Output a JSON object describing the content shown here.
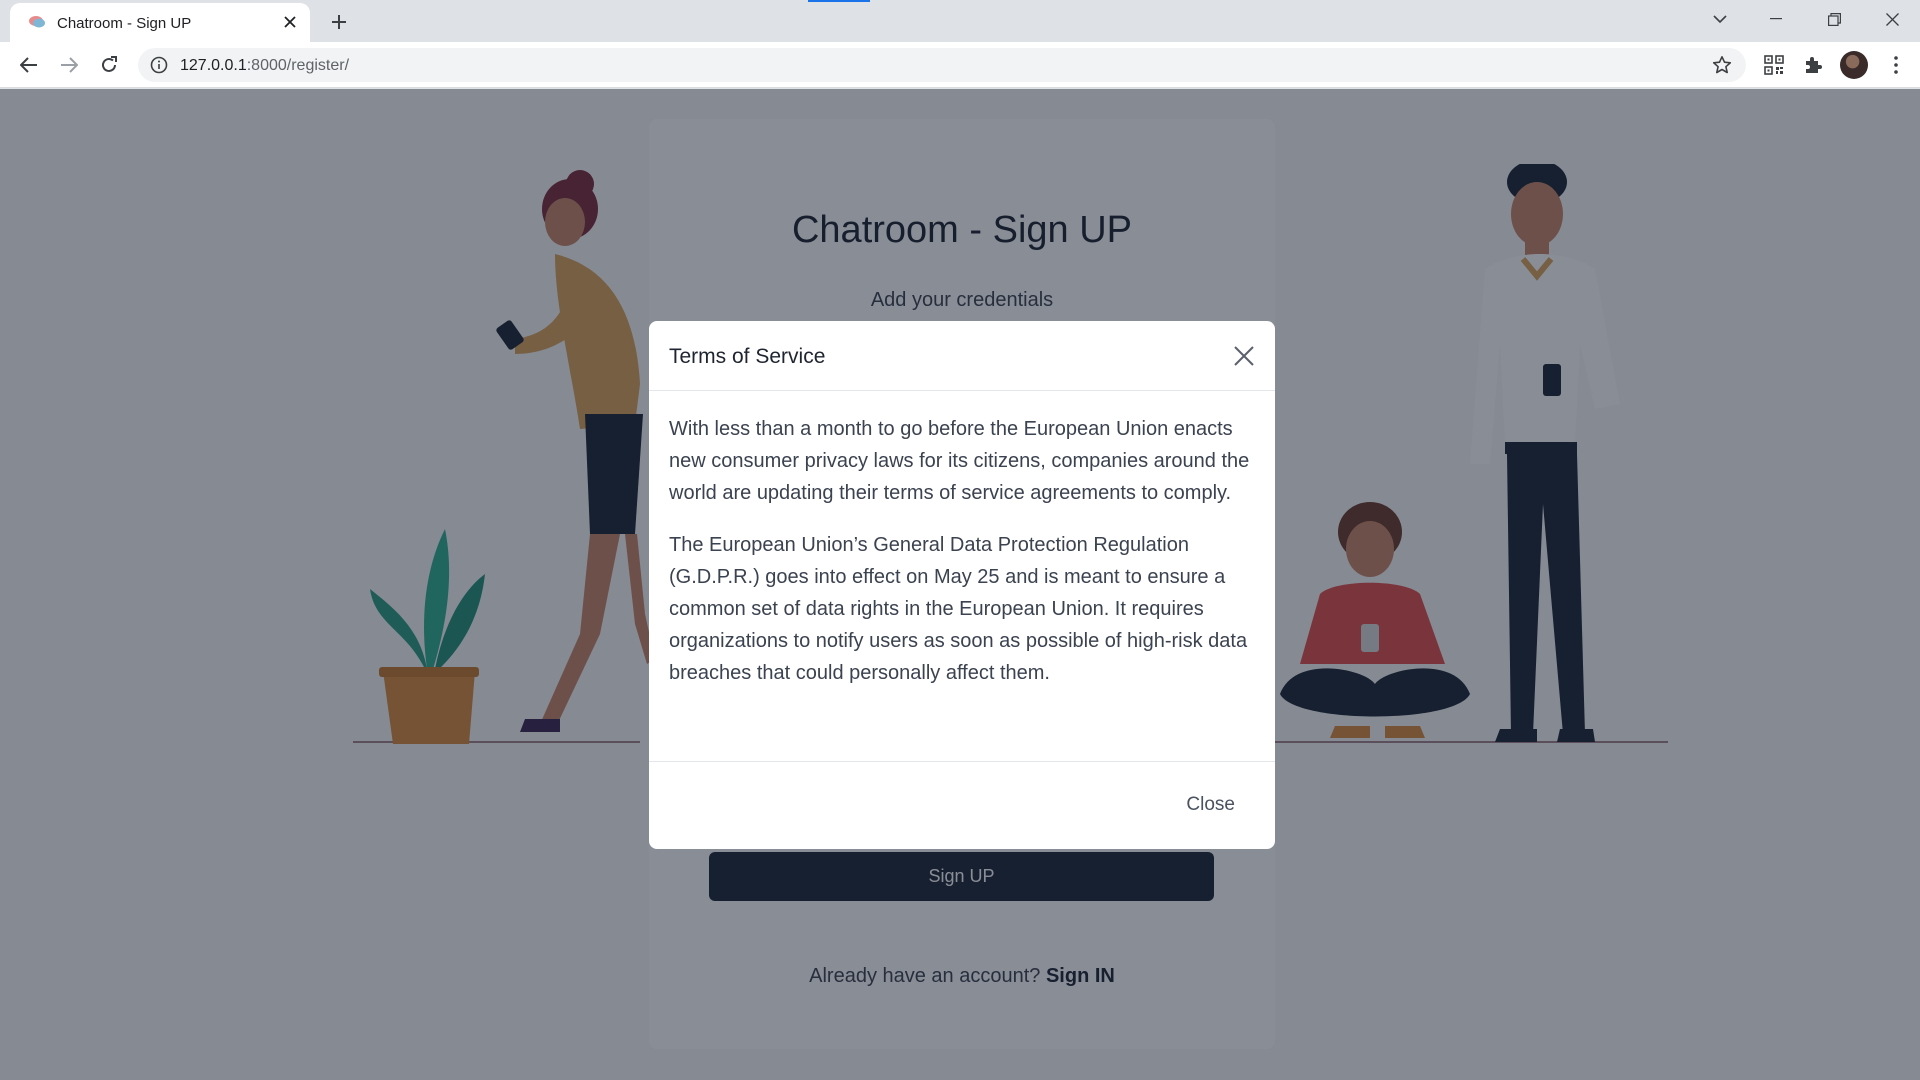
{
  "browser": {
    "tab_title": "Chatroom - Sign UP",
    "url_host": "127.0.0.1",
    "url_path": ":8000/register/"
  },
  "page": {
    "title": "Chatroom - Sign UP",
    "subtitle": "Add your credentials",
    "signup_button": "Sign UP",
    "signin_prompt": "Already have an account?",
    "signin_link": "Sign IN"
  },
  "modal": {
    "title": "Terms of Service",
    "paragraphs": [
      "With less than a month to go before the European Union enacts new consumer privacy laws for its citizens, companies around the world are updating their terms of service agreements to comply.",
      "The European Union’s General Data Protection Regulation (G.D.P.R.) goes into effect on May 25 and is meant to ensure a common set of data rights in the European Union. It requires organizations to notify users as soon as possible of high-risk data breaches that could personally affect them."
    ],
    "close_label": "Close"
  },
  "colors": {
    "accent": "#1b2535",
    "backdrop": "rgba(20, 28, 44, 0.5)"
  }
}
